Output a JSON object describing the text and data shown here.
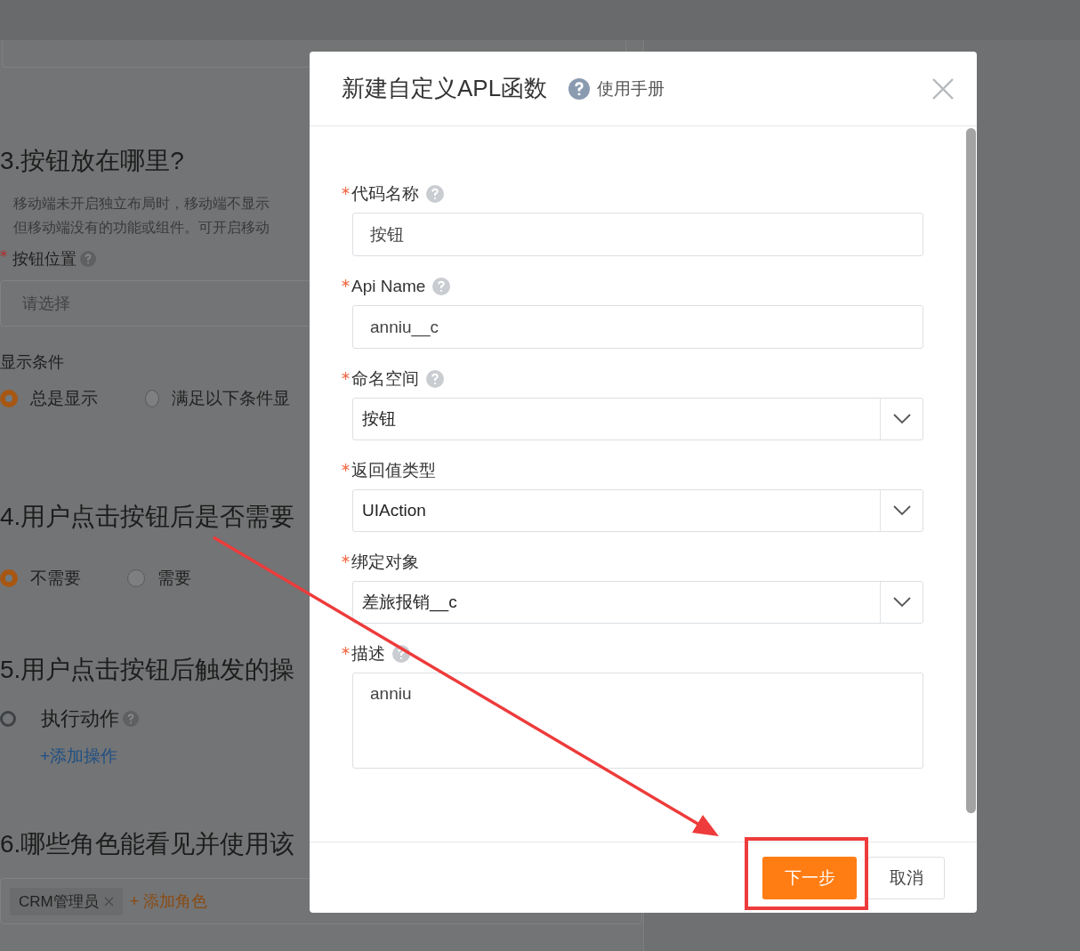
{
  "background_form": {
    "section_3": {
      "heading": "3.按钮放在哪里?",
      "notes": [
        "移动端未开启独立布局时，移动端不显示",
        "但移动端没有的功能或组件。可开启移动"
      ],
      "position_label": "按钮位置",
      "position_placeholder": "请选择",
      "condition_label": "显示条件",
      "condition_options": [
        {
          "label": "总是显示",
          "selected": true
        },
        {
          "label": "满足以下条件显",
          "selected": false
        }
      ]
    },
    "section_4": {
      "heading": "4.用户点击按钮后是否需要",
      "options": [
        {
          "label": "不需要",
          "selected": true
        },
        {
          "label": "需要",
          "selected": false
        }
      ]
    },
    "section_5": {
      "heading": "5.用户点击按钮后触发的操",
      "action_label": "执行动作",
      "add_action_link": "+添加操作"
    },
    "section_6": {
      "heading": "6.哪些角色能看见并使用该",
      "roles": [
        "CRM管理员"
      ],
      "add_role_link": "+ 添加角色"
    }
  },
  "dialog": {
    "title": "新建自定义APL函数",
    "manual_link": "使用手册",
    "fields": [
      {
        "kind": "input",
        "label": "代码名称",
        "required": true,
        "help": true,
        "value": "按钮"
      },
      {
        "kind": "input",
        "label": "Api Name",
        "required": true,
        "help": true,
        "value": "anniu__c"
      },
      {
        "kind": "select",
        "label": "命名空间",
        "required": true,
        "help": true,
        "value": "按钮"
      },
      {
        "kind": "select",
        "label": "返回值类型",
        "required": true,
        "help": false,
        "value": "UIAction"
      },
      {
        "kind": "select",
        "label": "绑定对象",
        "required": true,
        "help": false,
        "value": "差旅报销__c"
      },
      {
        "kind": "textarea",
        "label": "描述",
        "required": true,
        "help": true,
        "value": "anniu"
      }
    ],
    "buttons": [
      {
        "kind": "primary",
        "label": "下一步"
      },
      {
        "kind": "default",
        "label": "取消"
      }
    ]
  }
}
